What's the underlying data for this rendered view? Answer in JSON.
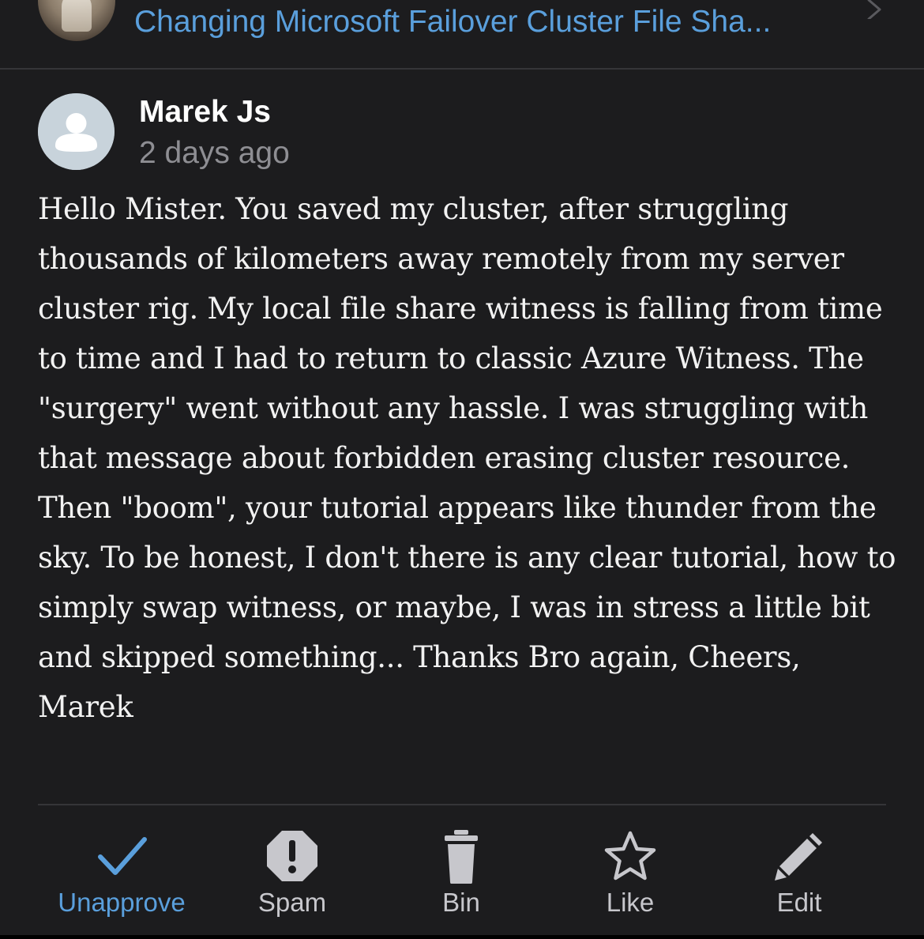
{
  "post": {
    "title": "Changing Microsoft Failover Cluster File Sha...",
    "thumbnail_icon": "post-thumbnail",
    "chevron_icon": "chevron-right-icon"
  },
  "comment": {
    "author": "Marek Js",
    "time": "2 days ago",
    "avatar_icon": "default-user-avatar",
    "text": "Hello Mister. You saved my cluster, after struggling thousands of kilometers away remotely from my server cluster rig. My local file share witness is falling from time to time and I had to return to classic Azure Witness. The \"surgery\" went without any hassle. I was struggling with that message about forbidden erasing cluster resource. Then \"boom\", your tutorial appears like thunder from the sky. To be honest, I don't there is any clear tutorial, how to simply swap witness, or maybe, I was in stress a little bit and skipped something... Thanks Bro again, Cheers, Marek"
  },
  "actions": [
    {
      "label": "Unapprove",
      "icon": "checkmark-icon"
    },
    {
      "label": "Spam",
      "icon": "exclamation-icon"
    },
    {
      "label": "Bin",
      "icon": "trash-icon"
    },
    {
      "label": "Like",
      "icon": "star-icon"
    },
    {
      "label": "Edit",
      "icon": "pencil-icon"
    }
  ],
  "colors": {
    "background": "#1c1c1e",
    "accent": "#5a9fdc",
    "secondary_text": "#8e8e93",
    "icon_gray": "#c7c7cc"
  }
}
